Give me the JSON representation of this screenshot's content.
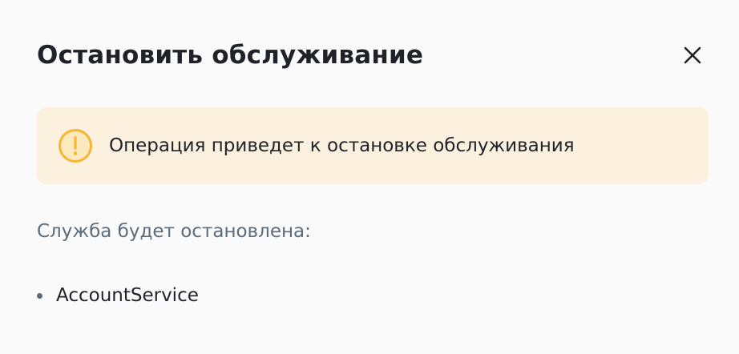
{
  "dialog": {
    "title": "Остановить обслуживание",
    "close_icon": "close-icon"
  },
  "alert": {
    "icon": "warning-icon",
    "icon_color": "#f5b731",
    "background": "#fcf1de",
    "message": "Операция приведет к остановке обслуживания"
  },
  "services": {
    "label": "Служба будет остановлена:",
    "items": [
      {
        "name": "AccountService"
      }
    ]
  }
}
